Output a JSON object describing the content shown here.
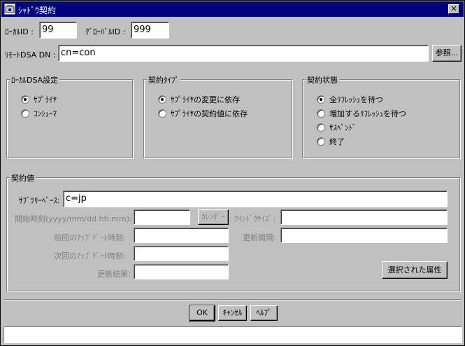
{
  "window": {
    "title": "ｼｬﾄﾞｳ契約",
    "close_glyph": "✕"
  },
  "top": {
    "local_id_label": "ﾛｰｶﾙID :",
    "local_id_value": "99",
    "global_id_label": "ｸﾞﾛｰﾊﾞﾙID :",
    "global_id_value": "999",
    "remote_dsa_label": "ﾘﾓｰﾄDSA DN :",
    "remote_dsa_value": "cn=con",
    "browse_label": "参照..."
  },
  "local_dsa": {
    "title": "ﾛｰｶﾙDSA設定",
    "options": [
      {
        "label": "ｻﾌﾟﾗｲﾔ",
        "selected": true
      },
      {
        "label": "ｺﾝｼｭｰﾏ",
        "selected": false
      }
    ]
  },
  "contract_type": {
    "title": "契約ﾀｲﾌﾟ",
    "options": [
      {
        "label": "ｻﾌﾟﾗｲﾔの変更に依存",
        "selected": true
      },
      {
        "label": "ｻﾌﾟﾗｲﾔの契約値に依存",
        "selected": false
      }
    ]
  },
  "contract_state": {
    "title": "契約状態",
    "options": [
      {
        "label": "全ﾘﾌﾚｯｼｭを待つ",
        "selected": true
      },
      {
        "label": "増加するﾘﾌﾚｯｼｭを待つ",
        "selected": false
      },
      {
        "label": "ｻｽﾍﾟﾝﾄﾞ",
        "selected": false
      },
      {
        "label": "終了",
        "selected": false
      }
    ]
  },
  "contract_value": {
    "title": "契約値",
    "subtree_base_label": "ｻﾌﾞﾂﾘｰﾍﾞｰｽ:",
    "subtree_base_value": "c=jp",
    "start_time_label": "開始時刻(yyyy/mm/dd hh:mm):",
    "start_time_value": "",
    "calendar_label": "ｶﾚﾝﾀﾞｰ",
    "window_size_label": "ｳｲﾝﾄﾞｳｻｲｽﾞ:",
    "window_size_value": "",
    "last_update_label": "前回のｱｯﾌﾟﾃﾞｰﾄ時刻:",
    "last_update_value": "",
    "update_interval_label": "更新間隔:",
    "update_interval_value": "",
    "next_update_label": "次回のｱｯﾌﾟﾃﾞｰﾄ時刻:",
    "next_update_value": "",
    "update_result_label": "更新結果:",
    "update_result_value": "",
    "selected_attrs_label": "選択された属性"
  },
  "footer": {
    "ok_label": "OK",
    "cancel_label": "ｷｬﾝｾﾙ",
    "help_label": "ﾍﾙﾌﾟ",
    "status_text": ""
  }
}
